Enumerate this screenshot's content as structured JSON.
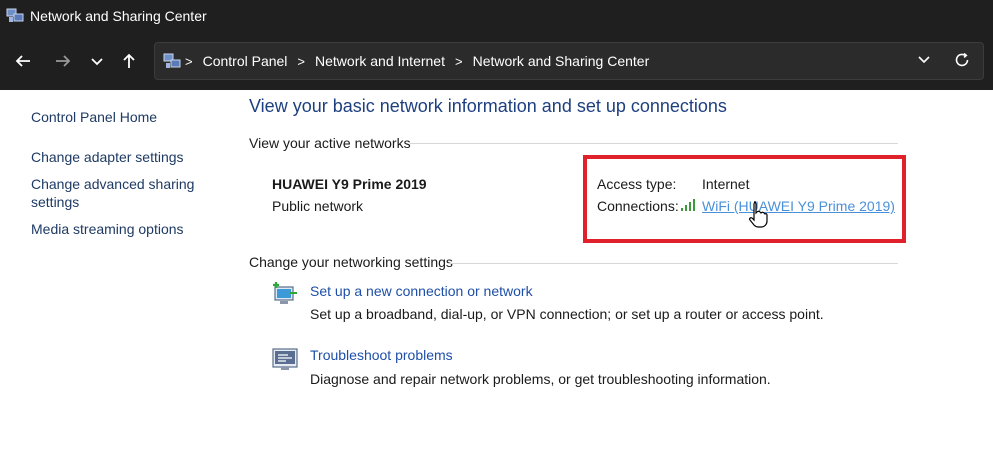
{
  "window": {
    "title": "Network and Sharing Center",
    "app_icon": "network-center-icon"
  },
  "toolbar": {
    "back_icon": "back-arrow-icon",
    "forward_icon": "forward-arrow-icon",
    "recent_icon": "chevron-down-icon",
    "up_icon": "up-arrow-icon",
    "breadcrumbs": [
      "Control Panel",
      "Network and Internet",
      "Network and Sharing Center"
    ],
    "address_dropdown_icon": "chevron-down-icon",
    "refresh_icon": "refresh-icon"
  },
  "sidebar": {
    "items": [
      {
        "label": "Control Panel Home"
      },
      {
        "label": "Change adapter settings"
      },
      {
        "label": "Change advanced sharing settings"
      },
      {
        "label": "Media streaming options"
      }
    ]
  },
  "main": {
    "heading": "View your basic network information and set up connections",
    "active_networks_label": "View your active networks",
    "network": {
      "name": "HUAWEI Y9 Prime 2019",
      "category": "Public network",
      "access_type_label": "Access type:",
      "access_type_value": "Internet",
      "connections_label": "Connections:",
      "connection_link": "WiFi (HUAWEI Y9 Prime 2019)"
    },
    "change_settings_label": "Change your networking settings",
    "tasks": [
      {
        "icon": "new-connection-icon",
        "link": "Set up a new connection or network",
        "description": "Set up a broadband, dial-up, or VPN connection; or set up a router or access point."
      },
      {
        "icon": "troubleshoot-icon",
        "link": "Troubleshoot problems",
        "description": "Diagnose and repair network problems, or get troubleshooting information."
      }
    ]
  },
  "colors": {
    "highlight_border": "#e0212b",
    "link_blue": "#1e4fa8",
    "wifi_link": "#4a90d9",
    "heading_blue": "#1e3f80",
    "titlebar_bg": "#1f1f1f"
  }
}
